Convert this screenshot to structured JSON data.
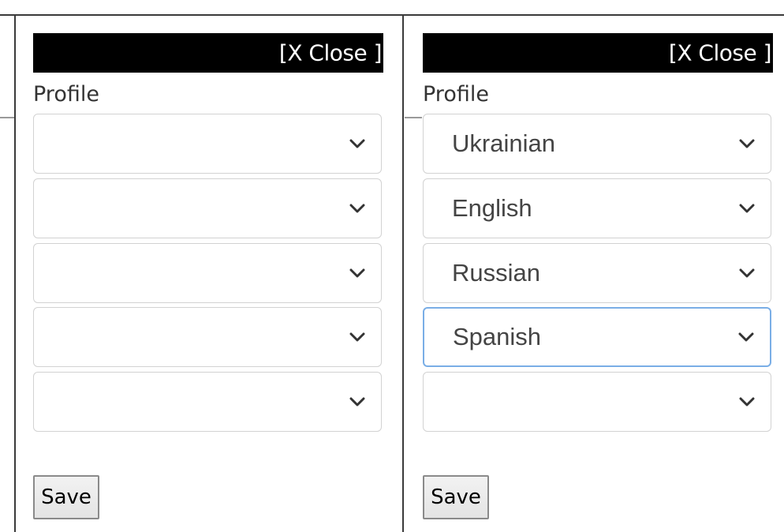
{
  "panels": [
    {
      "close_label": "[X Close ]",
      "profile_label": "Profile",
      "selects": [
        "",
        "",
        "",
        "",
        ""
      ],
      "save_label": "Save"
    },
    {
      "close_label": "[X Close ]",
      "profile_label": "Profile",
      "selects": [
        "Ukrainian",
        "English",
        "Russian",
        "Spanish",
        ""
      ],
      "focused_select": 4,
      "save_label": "Save"
    }
  ],
  "icons": {
    "select_arrow": "chevron-down-icon"
  }
}
